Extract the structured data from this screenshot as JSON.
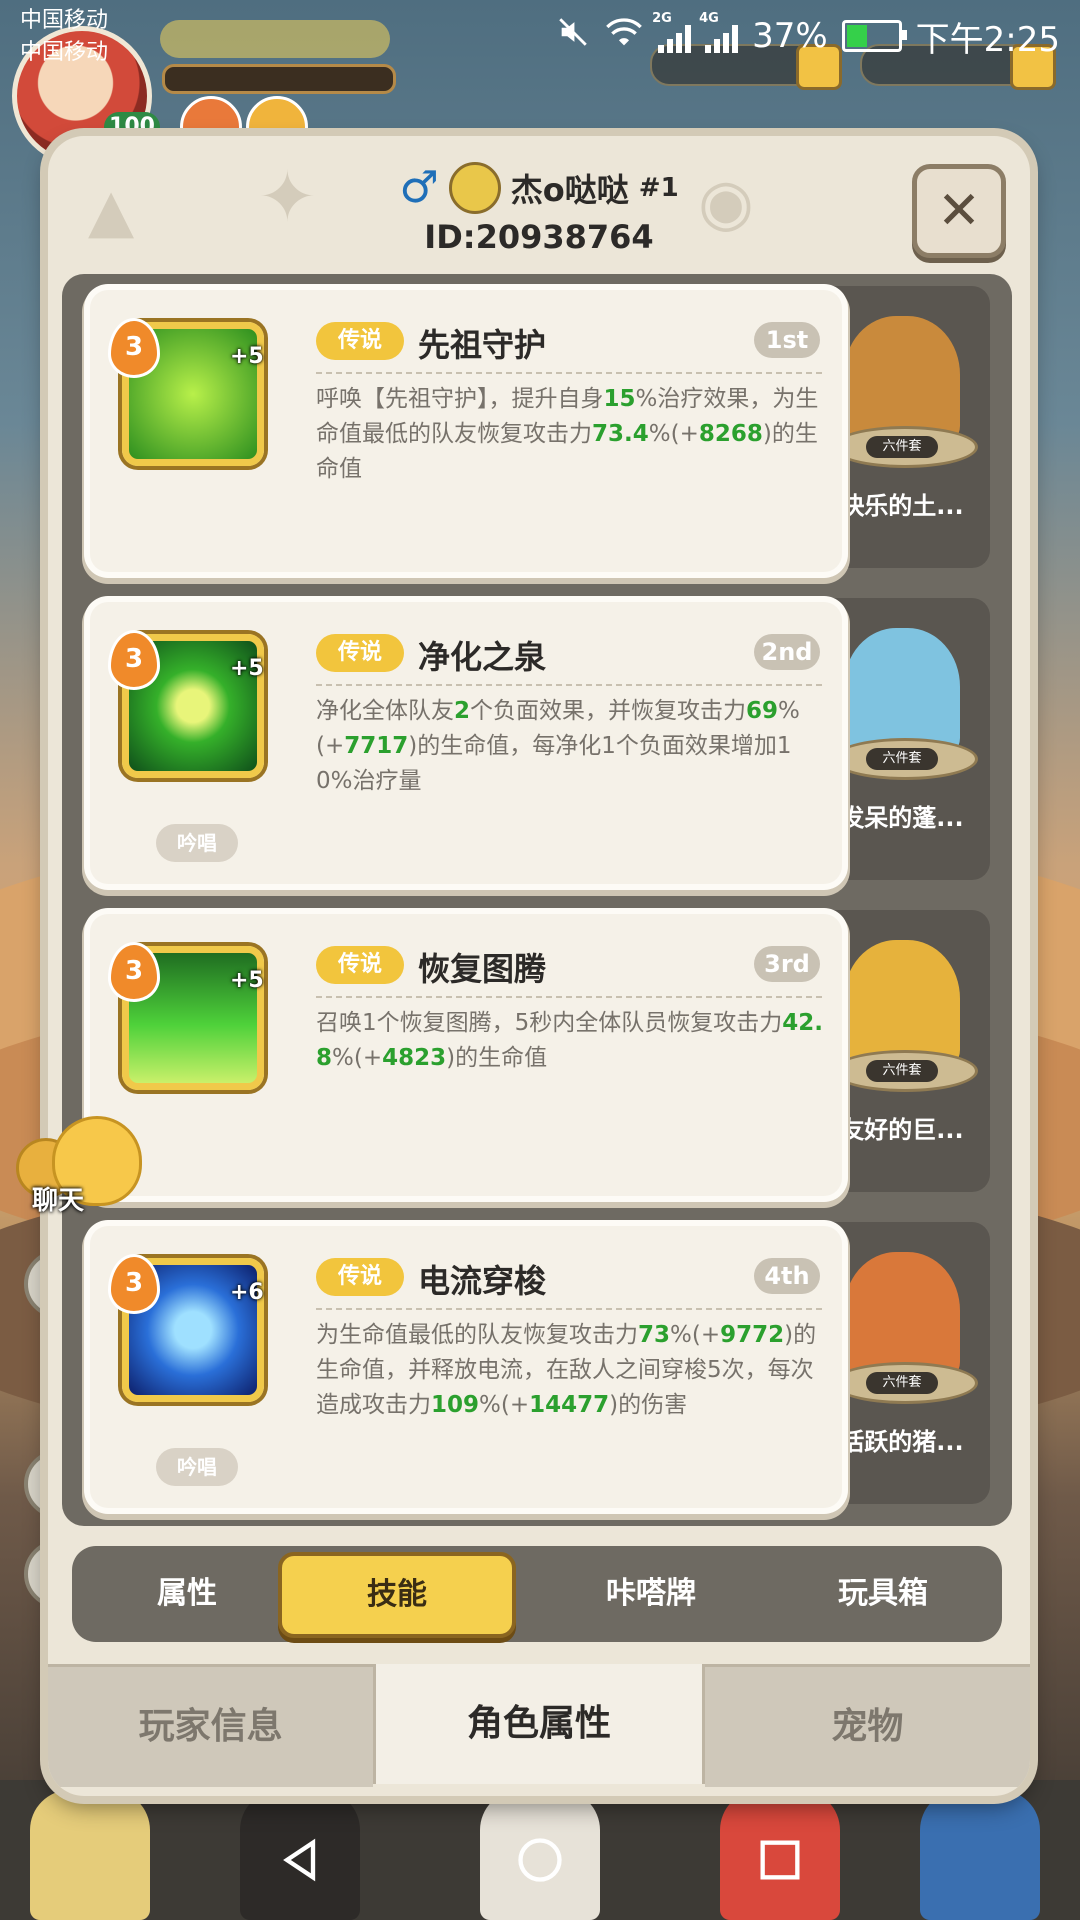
{
  "status_bar": {
    "carrier1": "中国移动",
    "carrier2": "中国移动",
    "sim1_network": "2G",
    "sim2_network": "4G",
    "battery": "37%",
    "time": "下午2:25"
  },
  "background": {
    "level": "100"
  },
  "profile": {
    "gender_icon": "male-icon",
    "name": "杰o哒哒",
    "rank": "#1",
    "id": "ID:20938764"
  },
  "skills": [
    {
      "level": "3",
      "plus": "+5",
      "tag": "传说",
      "name": "先祖守护",
      "rank": "1st",
      "desc": [
        {
          "t": "呼唤【先祖守护】，提升自身",
          "h": false
        },
        {
          "t": "15",
          "h": true
        },
        {
          "t": "%治疗效果，为生命值最低的队友恢复攻击力",
          "h": false
        },
        {
          "t": "73.4",
          "h": true
        },
        {
          "t": "%(+",
          "h": false
        },
        {
          "t": "8268",
          "h": true
        },
        {
          "t": ")的生命值",
          "h": false
        }
      ],
      "chant": "",
      "pet_name": "快乐的土...",
      "pet_tag": "六件套",
      "icon": "ancestor-guard-icon"
    },
    {
      "level": "3",
      "plus": "+5",
      "tag": "传说",
      "name": "净化之泉",
      "rank": "2nd",
      "desc": [
        {
          "t": "净化全体队友",
          "h": false
        },
        {
          "t": "2",
          "h": true
        },
        {
          "t": "个负面效果，并恢复攻击力",
          "h": false
        },
        {
          "t": "69",
          "h": true
        },
        {
          "t": "%(+",
          "h": false
        },
        {
          "t": "7717",
          "h": true
        },
        {
          "t": ")的生命值，每净化1个负面效果增加10%治疗量",
          "h": false
        }
      ],
      "chant": "吟唱",
      "pet_name": "发呆的蓬...",
      "pet_tag": "六件套",
      "icon": "purify-spring-icon"
    },
    {
      "level": "3",
      "plus": "+5",
      "tag": "传说",
      "name": "恢复图腾",
      "rank": "3rd",
      "desc": [
        {
          "t": "召唤1个恢复图腾，5秒内全体队员恢复攻击力",
          "h": false
        },
        {
          "t": "42.8",
          "h": true
        },
        {
          "t": "%(+",
          "h": false
        },
        {
          "t": "4823",
          "h": true
        },
        {
          "t": ")的生命值",
          "h": false
        }
      ],
      "chant": "",
      "pet_name": "友好的巨...",
      "pet_tag": "六件套",
      "icon": "healing-totem-icon"
    },
    {
      "level": "3",
      "plus": "+6",
      "tag": "传说",
      "name": "电流穿梭",
      "rank": "4th",
      "desc": [
        {
          "t": "为生命值最低的队友恢复攻击力",
          "h": false
        },
        {
          "t": "73",
          "h": true
        },
        {
          "t": "%(+",
          "h": false
        },
        {
          "t": "9772",
          "h": true
        },
        {
          "t": ")的生命值，并释放电流，在敌人之间穿梭5次，每次造成攻击力",
          "h": false
        },
        {
          "t": "109",
          "h": true
        },
        {
          "t": "%(+",
          "h": false
        },
        {
          "t": "14477",
          "h": true
        },
        {
          "t": ")的伤害",
          "h": false
        }
      ],
      "chant": "吟唱",
      "pet_name": "活跃的猪...",
      "pet_tag": "六件套",
      "icon": "electric-shuttle-icon"
    }
  ],
  "subtabs": [
    "属性",
    "技能",
    "咔嗒牌",
    "玩具箱"
  ],
  "main_tabs": [
    "玩家信息",
    "角色属性",
    "宠物"
  ],
  "chat_label": "聊天",
  "colors": {
    "highlight": "#2ba02e",
    "legend_tag": "#f2c53d",
    "active_tab": "#f5d04e"
  }
}
